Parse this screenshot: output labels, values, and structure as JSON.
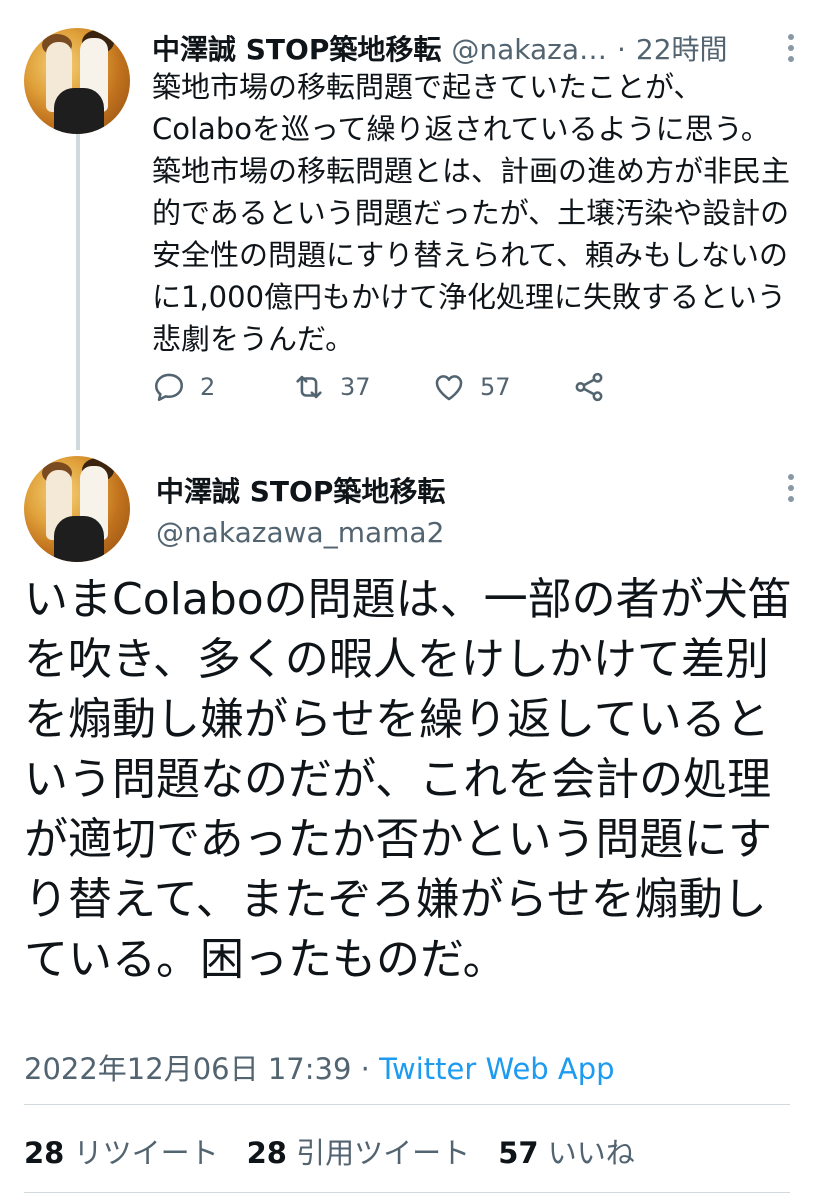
{
  "tweet1": {
    "display_name": "中澤誠 STOP築地移転",
    "handle": "@nakaza…",
    "dot": "·",
    "time": "22時間",
    "text": "築地市場の移転問題で起きていたことが、Colaboを巡って繰り返されているように思う。築地市場の移転問題とは、計画の進め方が非民主的であるという問題だったが、土壌汚染や設計の安全性の問題にすり替えられて、頼みもしないのに1,000億円もかけて浄化処理に失敗するという悲劇をうんだ。",
    "actions": {
      "reply_count": "2",
      "retweet_count": "37",
      "like_count": "57"
    }
  },
  "tweet2": {
    "display_name": "中澤誠 STOP築地移転",
    "handle": "@nakazawa_mama2",
    "text": "いまColaboの問題は、一部の者が犬笛を吹き、多くの暇人をけしかけて差別を煽動し嫌がらせを繰り返しているという問題なのだが、これを会計の処理が適切であったか否かという問題にすり替えて、またぞろ嫌がらせを煽動している。困ったものだ。",
    "timestamp": "2022年12月06日 17:39",
    "dot": "·",
    "source": "Twitter Web App",
    "stats": {
      "retweets_count": "28",
      "retweets_label": "リツイート",
      "quotes_count": "28",
      "quotes_label": "引用ツイート",
      "likes_count": "57",
      "likes_label": "いいね"
    }
  },
  "colors": {
    "accent": "#1d9bf0",
    "secondary_text": "#536471",
    "primary_text": "#0f1419",
    "divider": "#cfd9de"
  },
  "icons": [
    "reply-icon",
    "retweet-icon",
    "like-icon",
    "share-icon",
    "more-icon"
  ]
}
